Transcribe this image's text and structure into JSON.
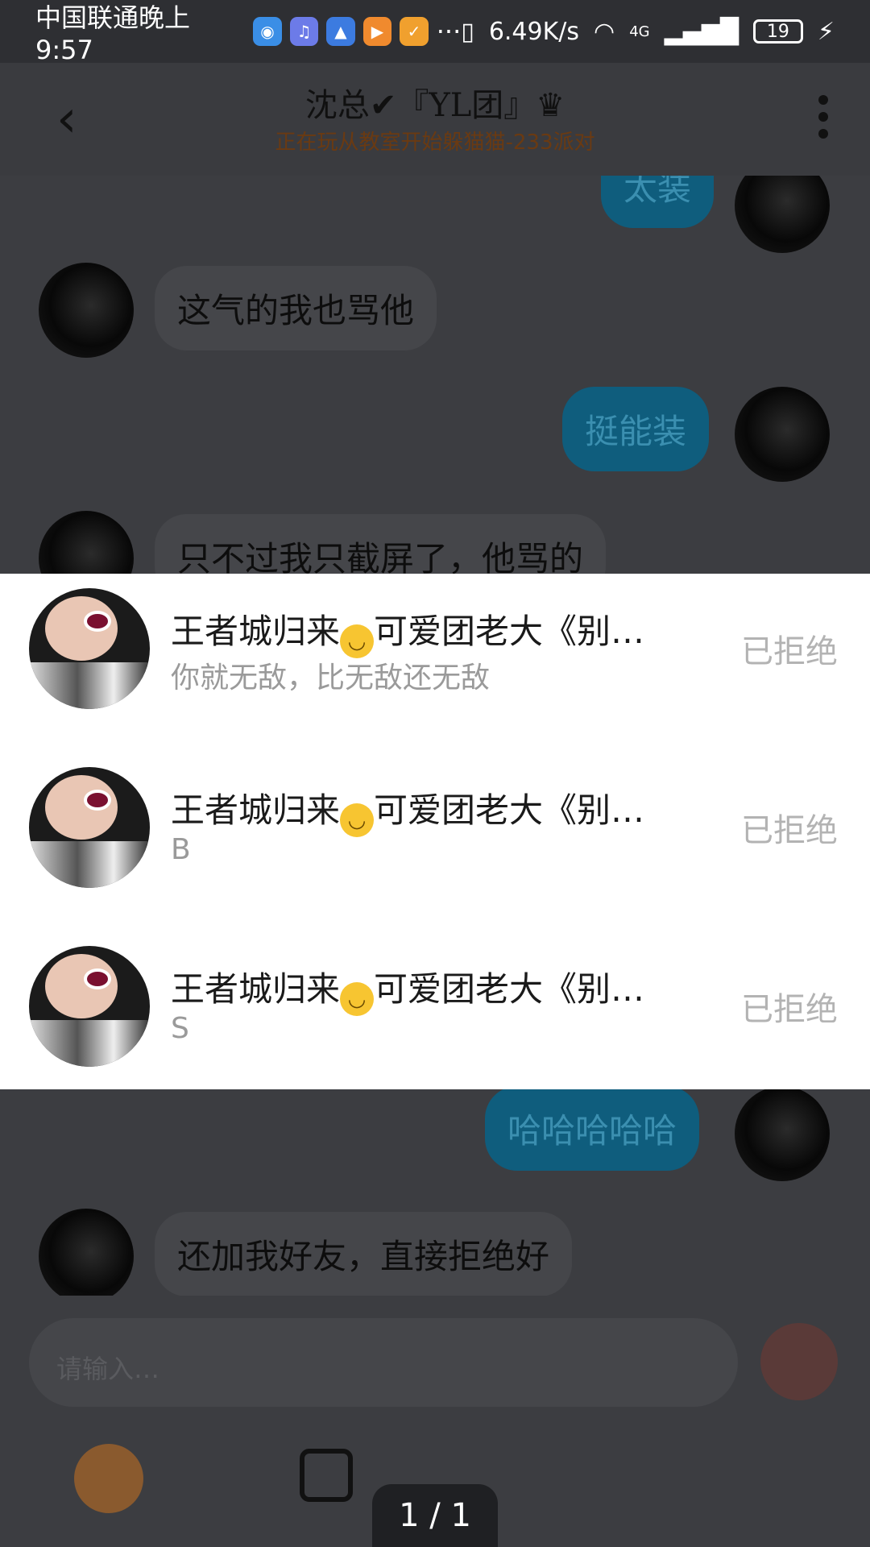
{
  "status_bar": {
    "carrier_time": "中国联通晚上9:57",
    "more": "···",
    "net_speed": "6.49K/s",
    "network": "4G",
    "battery": "19"
  },
  "header": {
    "back_glyph": "‹",
    "title": "沈总✔『YL团』♛",
    "subtitle": "正在玩从教室开始躲猫猫-233派对"
  },
  "chat": {
    "messages": [
      {
        "side": "right",
        "text": "太装"
      },
      {
        "side": "left",
        "text": "这气的我也骂他"
      },
      {
        "side": "right",
        "text": "挺能装"
      },
      {
        "side": "left",
        "text": "只不过我只截屏了，他骂的"
      },
      {
        "side": "right",
        "text": "哈哈哈哈哈"
      },
      {
        "side": "left",
        "text": "还加我好友，直接拒绝好"
      }
    ]
  },
  "requests": [
    {
      "name_pre": "王者城归来",
      "emoji": "upside-down-face",
      "name_post": "可爱团老大《别…",
      "message": "你就无敌，比无敌还无敌",
      "status": "已拒绝"
    },
    {
      "name_pre": "王者城归来",
      "emoji": "upside-down-face",
      "name_post": "可爱团老大《别…",
      "message": "B",
      "status": "已拒绝"
    },
    {
      "name_pre": "王者城归来",
      "emoji": "upside-down-face",
      "name_post": "可爱团老大《别…",
      "message": "S",
      "status": "已拒绝"
    }
  ],
  "input": {
    "placeholder": "请输入…"
  },
  "pager": "1 / 1",
  "colors": {
    "status_bg": "#2e2f33",
    "chat_bg": "#3c3d41",
    "bubble_right": "#0f5d7d",
    "popup_bg": "#ffffff",
    "status_text": "#b3b3b3"
  }
}
